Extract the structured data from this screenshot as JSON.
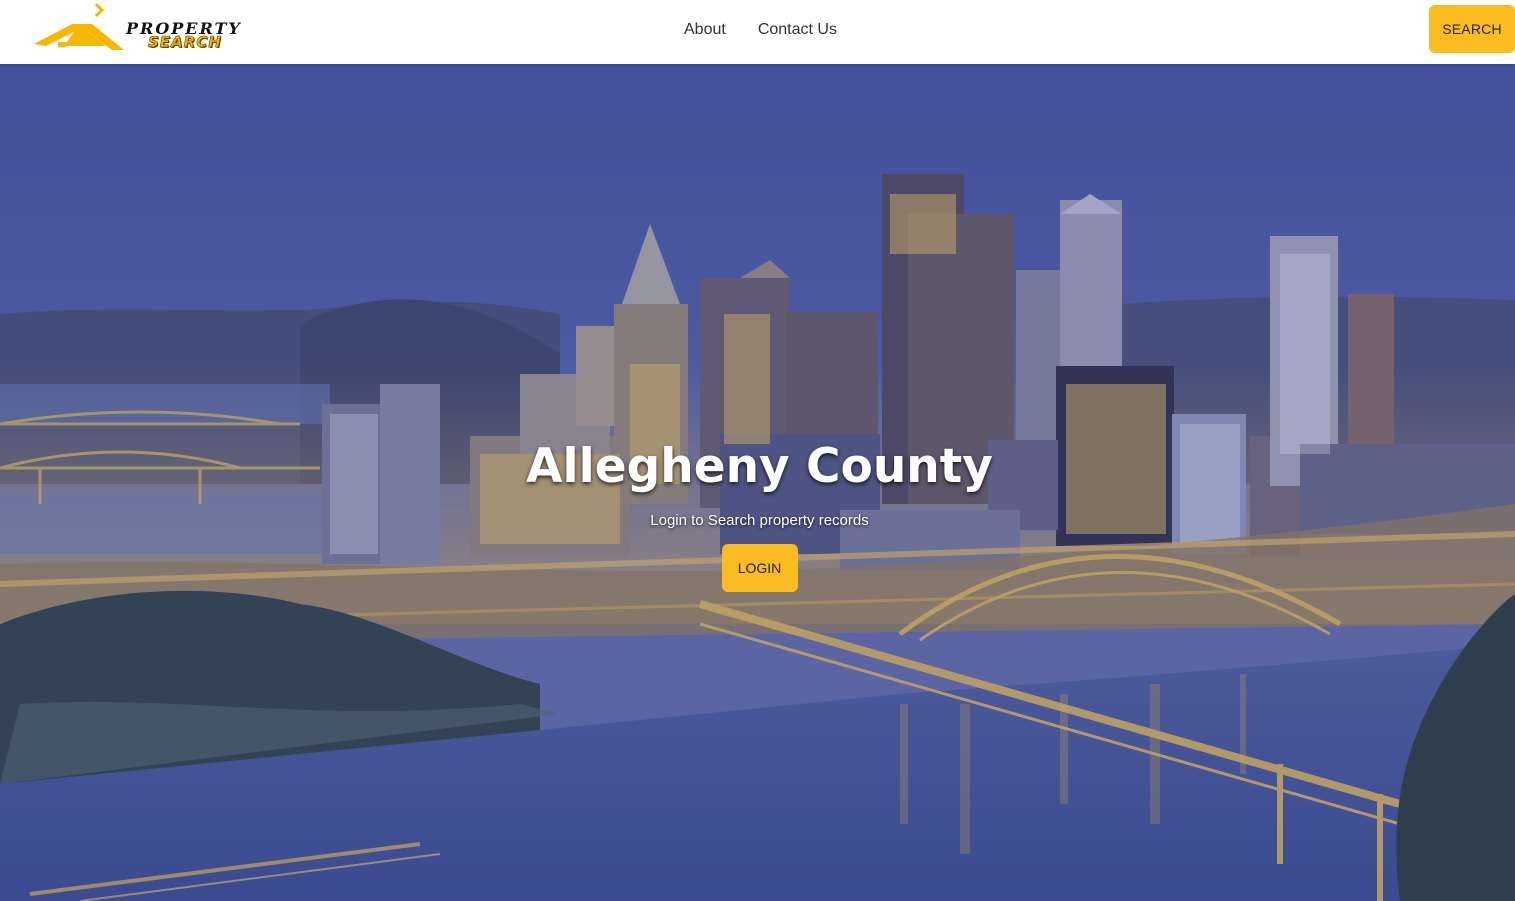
{
  "brand": {
    "line1": "PROPERTY",
    "line2": "SEARCH"
  },
  "nav": {
    "links": [
      "About",
      "Contact Us"
    ],
    "search_label": "SEARCH"
  },
  "hero": {
    "title": "Allegheny County",
    "subtitle": "Login to Search property records",
    "login_label": "LOGIN",
    "background": "city-skyline-at-dusk"
  },
  "colors": {
    "accent": "#fbbc21",
    "overlay": "#3b4a9e"
  }
}
